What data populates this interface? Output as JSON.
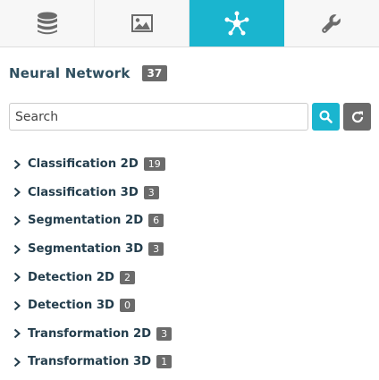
{
  "tabs": [
    {
      "icon": "database-icon",
      "active": false
    },
    {
      "icon": "image-icon",
      "active": false
    },
    {
      "icon": "network-icon",
      "active": true
    },
    {
      "icon": "wrench-icon",
      "active": false
    }
  ],
  "colors": {
    "accent": "#1ab5cf",
    "badge": "#6b6b6b",
    "label": "#233d4c"
  },
  "header": {
    "title": "Neural Network",
    "count": "37"
  },
  "search": {
    "placeholder": "Search",
    "value": ""
  },
  "buttons": {
    "search_icon": "search-icon",
    "refresh_icon": "refresh-icon"
  },
  "items": [
    {
      "label": "Classification 2D",
      "count": "19"
    },
    {
      "label": "Classification 3D",
      "count": "3"
    },
    {
      "label": "Segmentation 2D",
      "count": "6"
    },
    {
      "label": "Segmentation 3D",
      "count": "3"
    },
    {
      "label": "Detection 2D",
      "count": "2"
    },
    {
      "label": "Detection 3D",
      "count": "0"
    },
    {
      "label": "Transformation 2D",
      "count": "3"
    },
    {
      "label": "Transformation 3D",
      "count": "1"
    }
  ]
}
